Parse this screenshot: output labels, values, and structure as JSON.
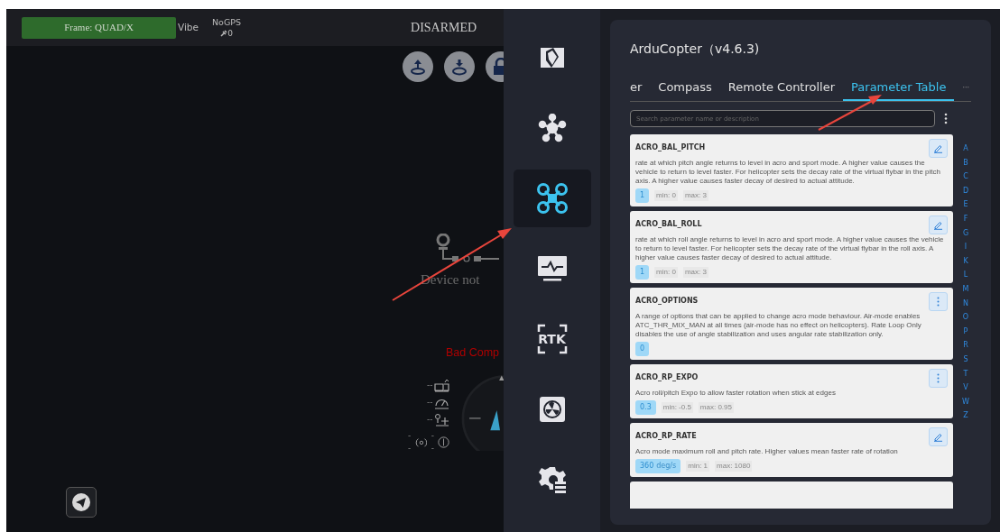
{
  "hud": {
    "frame": "Frame: QUAD/X",
    "vibe": "Vibe",
    "gps": "NoGPS",
    "satellites": "0",
    "arm_state": "DISARMED",
    "device": "Device not",
    "compass_warning": "Bad Comp",
    "dashes": [
      "--",
      "--",
      "--",
      "--",
      "--"
    ]
  },
  "sidebar": {
    "items": [
      {
        "kind": "camera",
        "selected": false
      },
      {
        "kind": "hub",
        "selected": false
      },
      {
        "kind": "drone",
        "selected": true
      },
      {
        "kind": "monitor",
        "selected": false
      },
      {
        "kind": "rtk",
        "label": "RTK",
        "selected": false
      },
      {
        "kind": "fan",
        "selected": false
      },
      {
        "kind": "gear",
        "selected": false
      }
    ]
  },
  "panel": {
    "title": "ArduCopter（v4.6.3)",
    "tabs": [
      {
        "label": "er",
        "selected": false
      },
      {
        "label": "Compass",
        "selected": false
      },
      {
        "label": "Remote Controller",
        "selected": false
      },
      {
        "label": "Parameter Table",
        "selected": true
      }
    ],
    "more": "···",
    "search": {
      "placeholder": "Search parameter name or description"
    },
    "params": [
      {
        "name": "ACRO_BAL_PITCH",
        "description": "rate at which pitch angle returns to level in acro and sport mode. A higher value causes the vehicle to return to level faster. For helicopter sets the decay rate of the virtual flybar in the pitch axis. A higher value causes faster decay of desired to actual attitude.",
        "value": "1",
        "min": "min: 0",
        "max": "max: 3",
        "kind": "edit"
      },
      {
        "name": "ACRO_BAL_ROLL",
        "description": "rate at which roll angle returns to level in acro and sport mode. A higher value causes the vehicle to return to level faster. For helicopter sets the decay rate of the virtual flybar in the roll axis. A higher value causes faster decay of desired to actual attitude.",
        "value": "1",
        "min": "min: 0",
        "max": "max: 3",
        "kind": "edit"
      },
      {
        "name": "ACRO_OPTIONS",
        "description": "A range of options that can be applied to change acro mode behaviour. Air-mode enables ATC_THR_MIX_MAN at all times (air-mode has no effect on helicopters). Rate Loop Only disables the use of angle stabilization and uses angular rate stabilization only.",
        "value": "0",
        "kind": "menu"
      },
      {
        "name": "ACRO_RP_EXPO",
        "description": "Acro roll/pitch Expo to allow faster rotation when stick at edges",
        "value": "0.3",
        "min": "min: -0.5",
        "max": "max: 0.95",
        "kind": "menu"
      },
      {
        "name": "ACRO_RP_RATE",
        "description": "Acro mode maximum roll and pitch rate. Higher values mean faster rate of rotation",
        "value": "360",
        "unit": "deg/s",
        "min": "min: 1",
        "max": "max: 1080",
        "kind": "edit"
      }
    ],
    "letters": [
      "A",
      "B",
      "C",
      "D",
      "E",
      "F",
      "G",
      "I",
      "K",
      "L",
      "M",
      "N",
      "O",
      "P",
      "R",
      "S",
      "T",
      "V",
      "W",
      "Z"
    ]
  }
}
